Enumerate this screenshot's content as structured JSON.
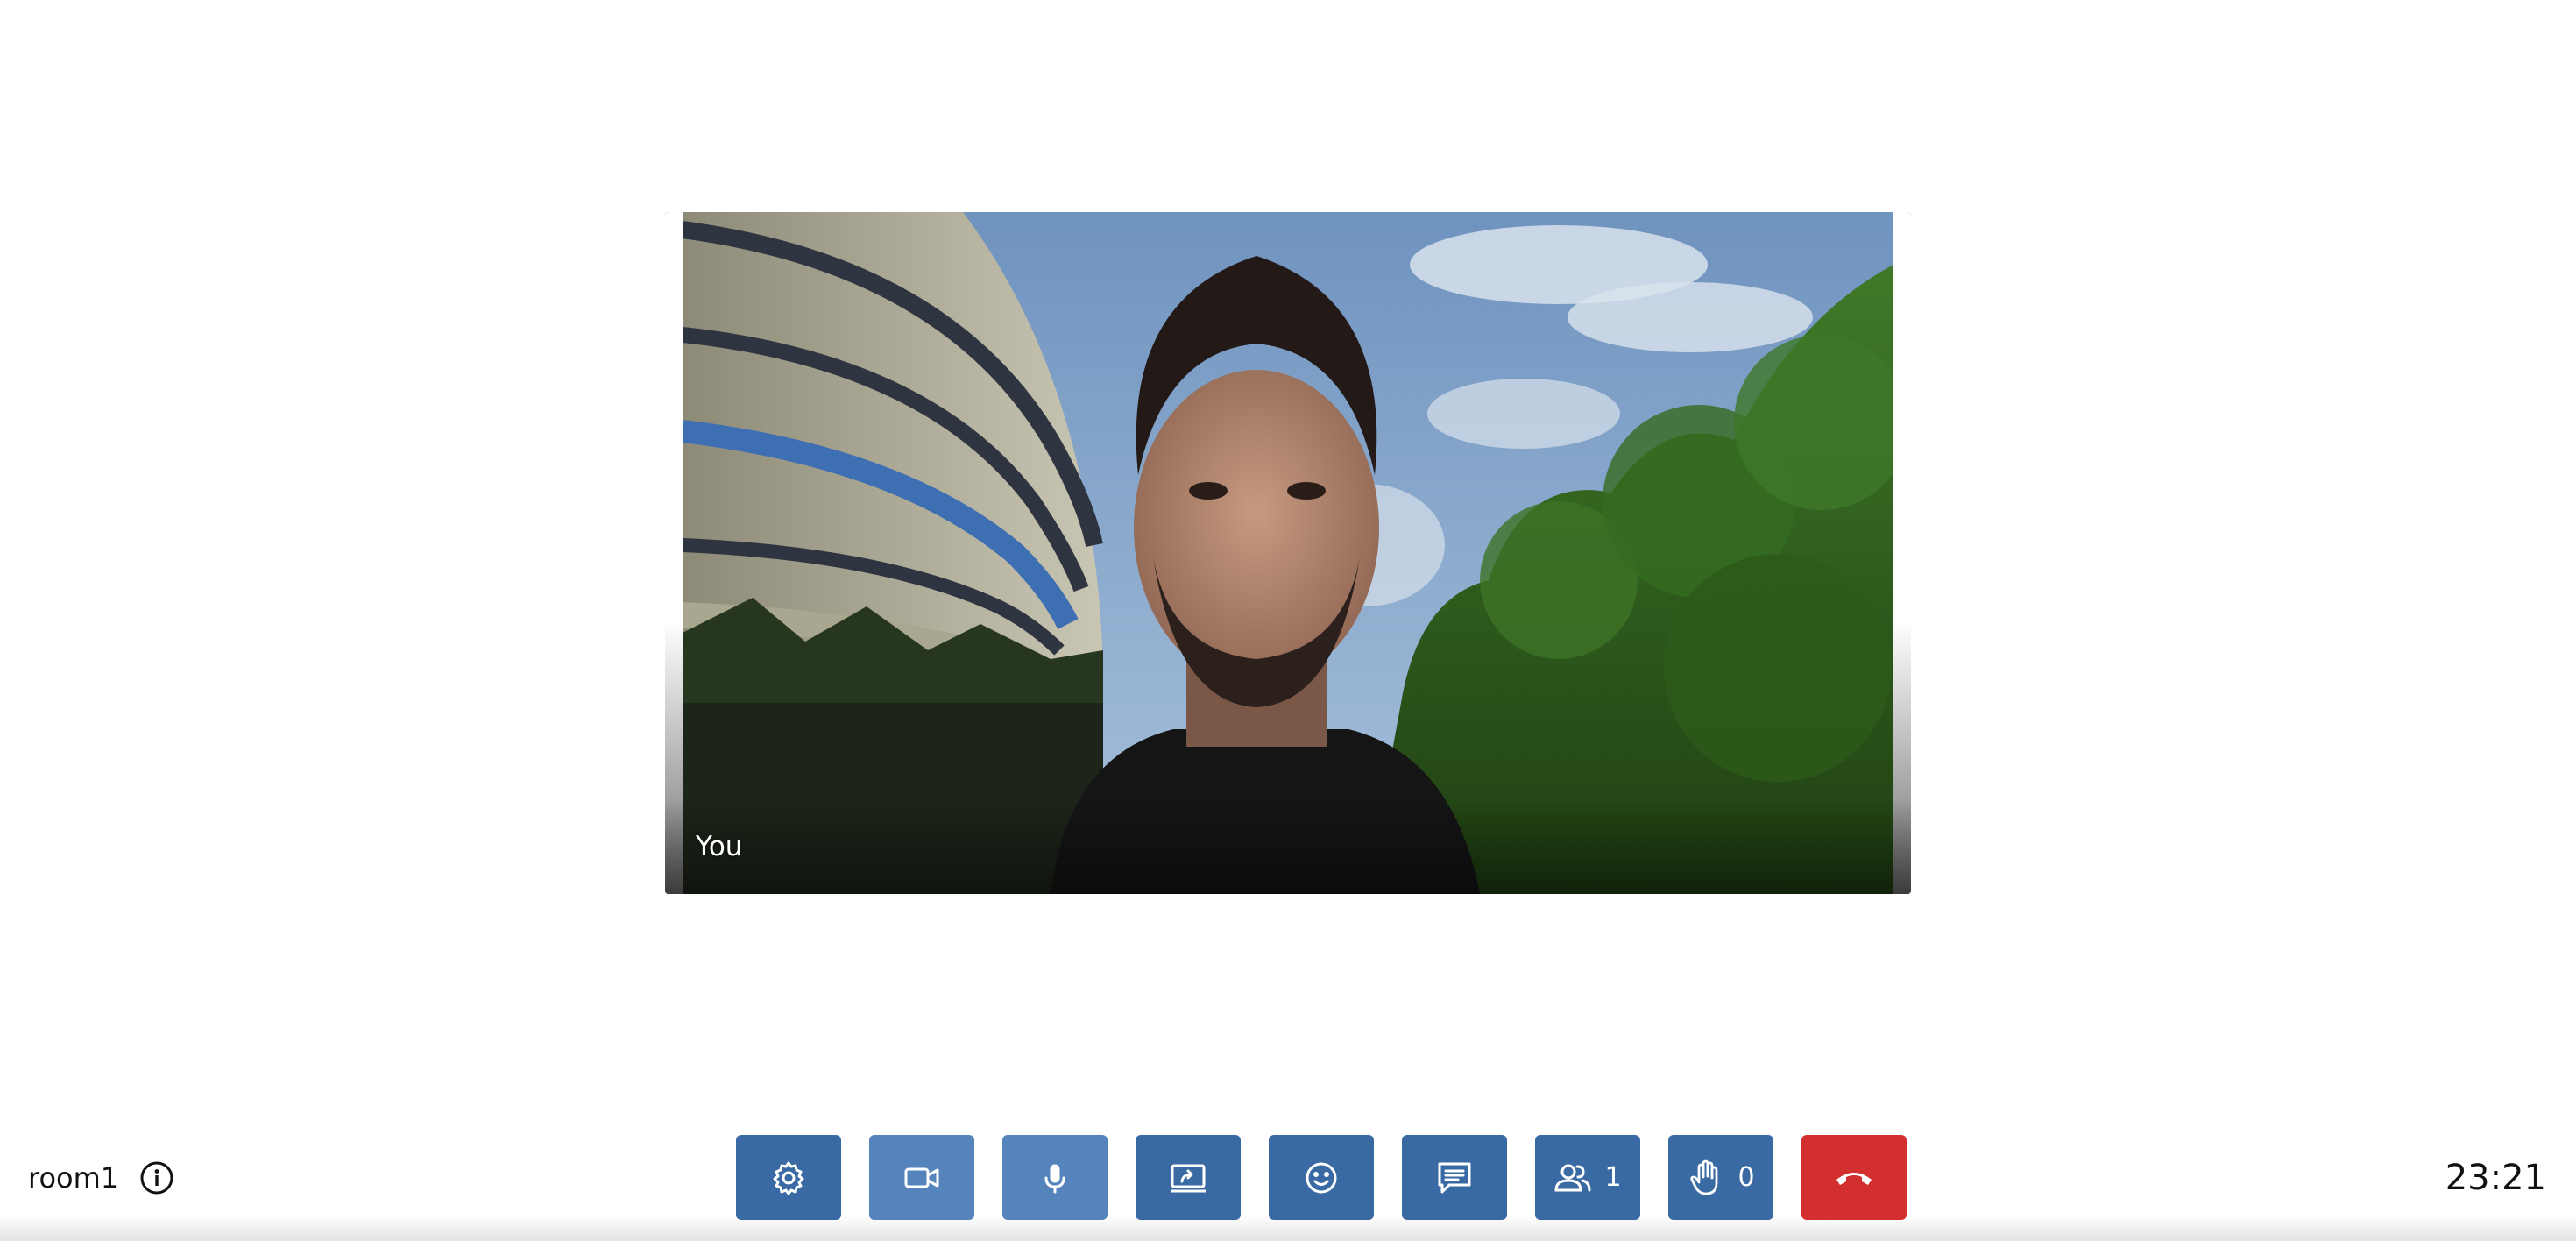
{
  "participant": {
    "name_tag": "You"
  },
  "room": {
    "name": "room1",
    "info_icon": "info-icon"
  },
  "toolbar": {
    "buttons": [
      {
        "icon": "gear-icon",
        "action": "settings"
      },
      {
        "icon": "video-camera-icon",
        "action": "camera"
      },
      {
        "icon": "microphone-icon",
        "action": "microphone"
      },
      {
        "icon": "screen-share-icon",
        "action": "share-screen"
      },
      {
        "icon": "smiley-icon",
        "action": "reactions"
      },
      {
        "icon": "chat-icon",
        "action": "chat"
      },
      {
        "icon": "participants-icon",
        "action": "participants",
        "count": "1"
      },
      {
        "icon": "raised-hand-icon",
        "action": "raise-hand",
        "count": "0"
      },
      {
        "icon": "hang-up-icon",
        "action": "leave"
      }
    ]
  },
  "clock": "23:21",
  "colors": {
    "toolbar_button": "#3a6aa3",
    "toolbar_button_active": "#5584bd",
    "hangup_button": "#d42f2f"
  }
}
